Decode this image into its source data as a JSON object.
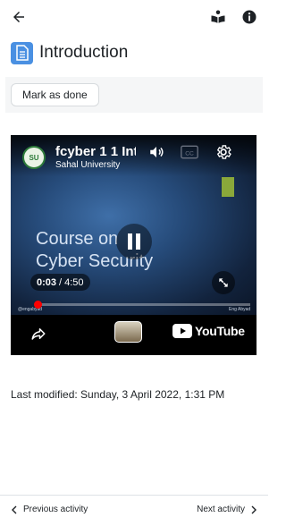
{
  "topbar": {
    "back_icon": "arrow-left-icon",
    "book_icon": "book-reader-icon",
    "info_icon": "info-circle-icon"
  },
  "page": {
    "title": "Introduction",
    "title_icon": "document-icon",
    "accent": "#4a90e2"
  },
  "completion": {
    "mark_label": "Mark as done"
  },
  "video": {
    "title": "fcyber 1 1 Int",
    "channel": "Sahal University",
    "slide_line1": "Course on",
    "slide_line2": "Cyber Security",
    "current_time": "0:03",
    "duration": "4:50",
    "time_separator": "/",
    "watermark_left": "@engabyad",
    "watermark_right": "Eng Abyad",
    "progress_fraction": 0.01,
    "brand": "YouTube",
    "progress_color": "#ff0000"
  },
  "meta": {
    "last_modified": "Last modified: Sunday, 3 April 2022, 1:31 PM"
  },
  "footer": {
    "previous_label": "Previous activity",
    "next_label": "Next activity"
  }
}
